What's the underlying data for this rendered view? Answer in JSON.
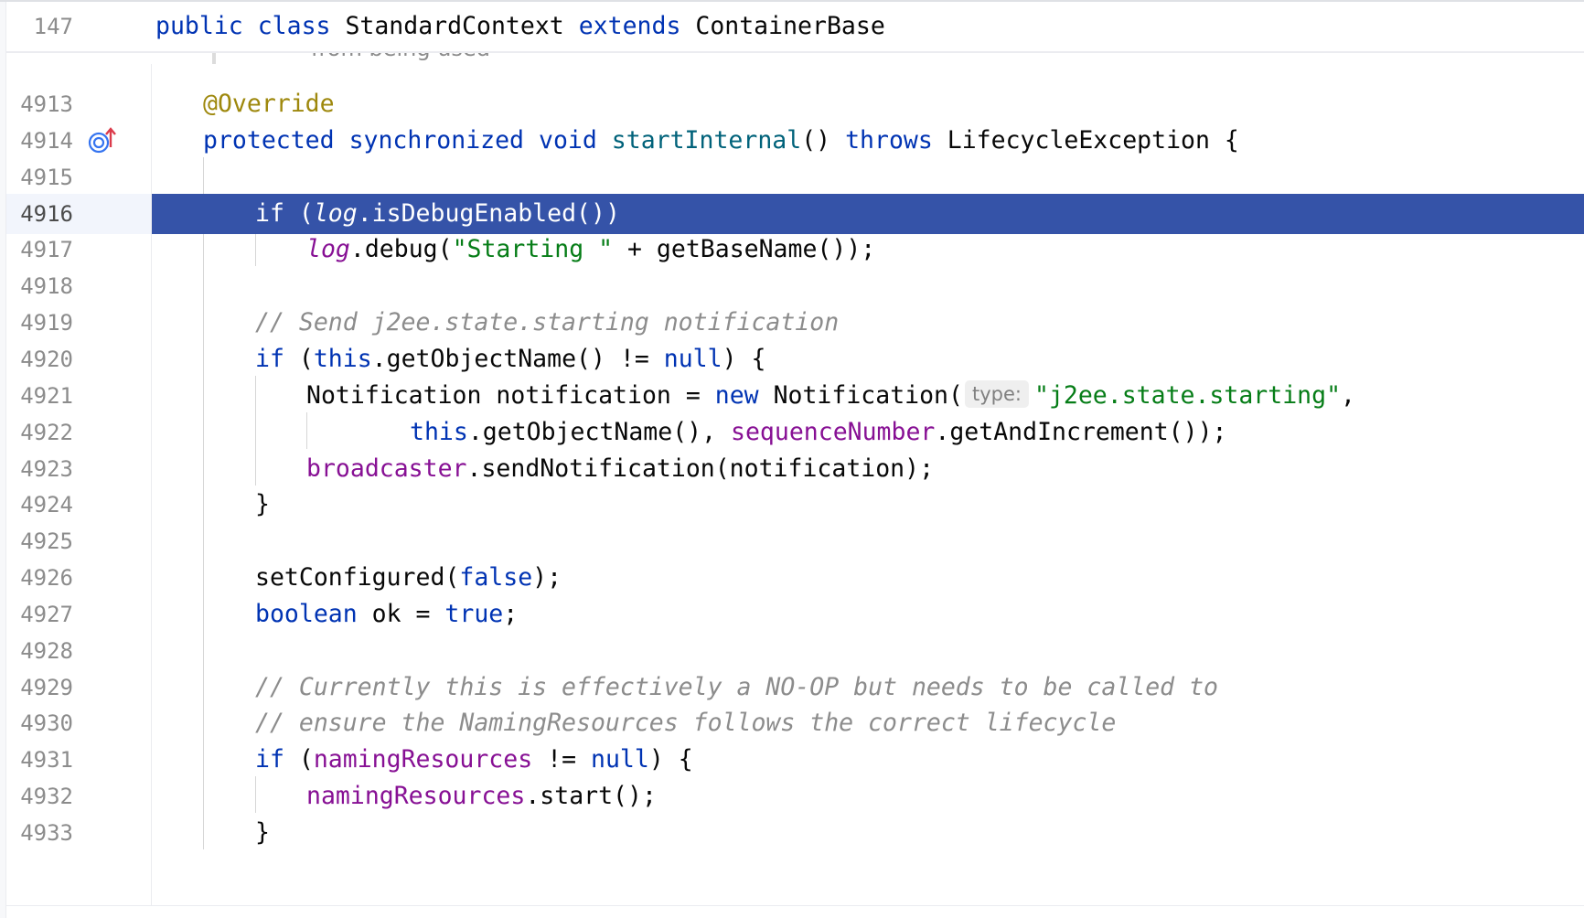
{
  "sticky_header": {
    "line_number": "147",
    "tokens": [
      {
        "t": "public",
        "c": "kw"
      },
      {
        "t": " "
      },
      {
        "t": "class",
        "c": "kw"
      },
      {
        "t": " StandardContext "
      },
      {
        "t": "extends",
        "c": "kw"
      },
      {
        "t": " ContainerBase"
      }
    ]
  },
  "folded_hint_text": "from being used",
  "gutter": {
    "override_icon": "override-up-arrow-icon"
  },
  "current_line": "4916",
  "selected_line": "4916",
  "lines": [
    {
      "n": "4913",
      "indent": 1,
      "tokens": [
        {
          "t": "@Override",
          "c": "ann"
        }
      ]
    },
    {
      "n": "4914",
      "indent": 1,
      "icon": true,
      "tokens": [
        {
          "t": "protected",
          "c": "kw"
        },
        {
          "t": " "
        },
        {
          "t": "synchronized",
          "c": "kw"
        },
        {
          "t": " "
        },
        {
          "t": "void",
          "c": "kw"
        },
        {
          "t": " "
        },
        {
          "t": "startInternal",
          "c": "fn"
        },
        {
          "t": "() "
        },
        {
          "t": "throws",
          "c": "kw"
        },
        {
          "t": " LifecycleException {"
        }
      ]
    },
    {
      "n": "4915",
      "indent": 1,
      "tokens": []
    },
    {
      "n": "4916",
      "indent": 2,
      "tokens": [
        {
          "t": "if",
          "c": "kw"
        },
        {
          "t": " ("
        },
        {
          "t": "log",
          "c": "fld it"
        },
        {
          "t": ".isDebugEnabled())"
        }
      ]
    },
    {
      "n": "4917",
      "indent": 3,
      "tokens": [
        {
          "t": "log",
          "c": "fld it"
        },
        {
          "t": ".debug("
        },
        {
          "t": "\"Starting \"",
          "c": "str"
        },
        {
          "t": " + getBaseName());"
        }
      ]
    },
    {
      "n": "4918",
      "indent": 2,
      "tokens": []
    },
    {
      "n": "4919",
      "indent": 2,
      "tokens": [
        {
          "t": "// Send j2ee.state.starting notification",
          "c": "cmt"
        }
      ]
    },
    {
      "n": "4920",
      "indent": 2,
      "tokens": [
        {
          "t": "if",
          "c": "kw"
        },
        {
          "t": " ("
        },
        {
          "t": "this",
          "c": "kw"
        },
        {
          "t": ".getObjectName() != "
        },
        {
          "t": "null",
          "c": "kw"
        },
        {
          "t": ") {"
        }
      ]
    },
    {
      "n": "4921",
      "indent": 3,
      "tokens": [
        {
          "t": "Notification notification = "
        },
        {
          "t": "new",
          "c": "kw"
        },
        {
          "t": " Notification("
        },
        {
          "t": "type:",
          "c": "hint"
        },
        {
          "t": "\"j2ee.state.starting\"",
          "c": "str"
        },
        {
          "t": ","
        }
      ]
    },
    {
      "n": "4922",
      "indent": 5,
      "tokens": [
        {
          "t": "this",
          "c": "kw"
        },
        {
          "t": ".getObjectName(), "
        },
        {
          "t": "sequenceNumber",
          "c": "fld"
        },
        {
          "t": ".getAndIncrement());"
        }
      ]
    },
    {
      "n": "4923",
      "indent": 3,
      "tokens": [
        {
          "t": "broadcaster",
          "c": "fld"
        },
        {
          "t": ".sendNotification(notification);"
        }
      ]
    },
    {
      "n": "4924",
      "indent": 2,
      "tokens": [
        {
          "t": "}"
        }
      ]
    },
    {
      "n": "4925",
      "indent": 2,
      "tokens": []
    },
    {
      "n": "4926",
      "indent": 2,
      "tokens": [
        {
          "t": "setConfigured("
        },
        {
          "t": "false",
          "c": "kw"
        },
        {
          "t": ");"
        }
      ]
    },
    {
      "n": "4927",
      "indent": 2,
      "tokens": [
        {
          "t": "boolean",
          "c": "kw"
        },
        {
          "t": " ok = "
        },
        {
          "t": "true",
          "c": "kw"
        },
        {
          "t": ";"
        }
      ]
    },
    {
      "n": "4928",
      "indent": 2,
      "tokens": []
    },
    {
      "n": "4929",
      "indent": 2,
      "tokens": [
        {
          "t": "// Currently this is effectively a NO-OP but needs to be called to",
          "c": "cmt"
        }
      ]
    },
    {
      "n": "4930",
      "indent": 2,
      "tokens": [
        {
          "t": "// ensure the NamingResources follows the correct lifecycle",
          "c": "cmt"
        }
      ]
    },
    {
      "n": "4931",
      "indent": 2,
      "tokens": [
        {
          "t": "if",
          "c": "kw"
        },
        {
          "t": " ("
        },
        {
          "t": "namingResources",
          "c": "fld"
        },
        {
          "t": " != "
        },
        {
          "t": "null",
          "c": "kw"
        },
        {
          "t": ") {"
        }
      ]
    },
    {
      "n": "4932",
      "indent": 3,
      "tokens": [
        {
          "t": "namingResources",
          "c": "fld"
        },
        {
          "t": ".start();"
        }
      ]
    },
    {
      "n": "4933",
      "indent": 2,
      "tokens": [
        {
          "t": "}"
        }
      ]
    }
  ]
}
